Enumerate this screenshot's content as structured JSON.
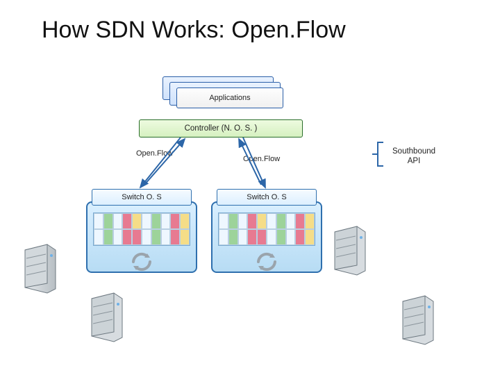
{
  "title": "How SDN Works: Open.Flow",
  "apps": {
    "label": "Applications"
  },
  "controller": {
    "label": "Controller (N. O. S. )"
  },
  "openflow": {
    "left": "Open.Flow",
    "right": "Open.Flow"
  },
  "switches": {
    "left_os": "Switch O. S",
    "right_os": "Switch O. S"
  },
  "southbound": {
    "line1": "Southbound",
    "line2": "API"
  },
  "colors": {
    "controller_border": "#2a6e2a",
    "switch_border": "#2e6fae",
    "match": "#9dd39a",
    "reject": "#e77a91",
    "pending": "#f5dd88"
  }
}
